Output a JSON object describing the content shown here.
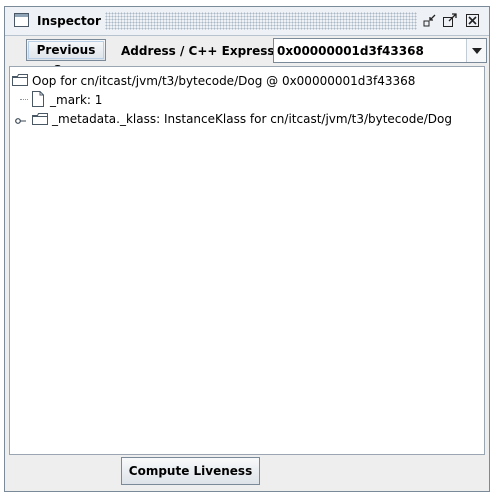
{
  "window": {
    "title": "Inspector",
    "icons": [
      "window-icon",
      "minimize-icon",
      "maximize-icon",
      "close-icon"
    ]
  },
  "toolbar": {
    "previous_label": "Previous Oop",
    "address_label": "Address / C++ Expression:",
    "address_value": "0x00000001d3f43368"
  },
  "tree": {
    "root": "Oop for cn/itcast/jvm/t3/bytecode/Dog @ 0x00000001d3f43368",
    "children": [
      "_mark: 1",
      "_metadata._klass: InstanceKlass for cn/itcast/jvm/t3/bytecode/Dog"
    ]
  },
  "bottom": {
    "liveness_label": "Compute Liveness"
  }
}
